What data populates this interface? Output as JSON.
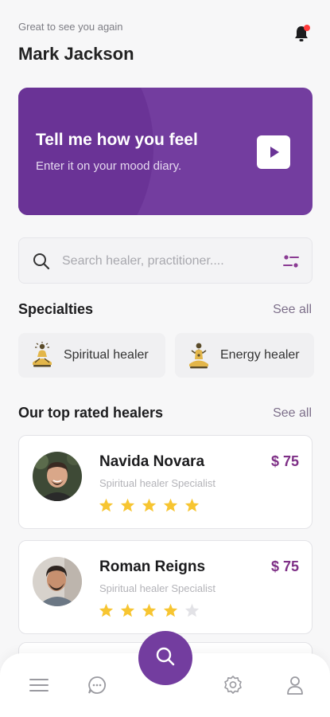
{
  "header": {
    "greeting": "Great to see you again",
    "username": "Mark Jackson",
    "notification_icon": "bell-icon"
  },
  "banner": {
    "title": "Tell me how you feel",
    "subtitle": "Enter it on your mood diary.",
    "action_icon": "play-icon",
    "color": "#733d9f"
  },
  "search": {
    "placeholder": "Search healer, practitioner....",
    "value": "",
    "icon": "search-icon",
    "filter_icon": "filter-icon"
  },
  "specialties": {
    "title": "Specialties",
    "see_all": "See all",
    "items": [
      {
        "label": "Spiritual healer",
        "icon": "spiritual-healer-icon"
      },
      {
        "label": "Energy healer",
        "icon": "energy-healer-icon"
      }
    ]
  },
  "healers": {
    "title": "Our top rated healers",
    "see_all": "See all",
    "items": [
      {
        "name": "Navida Novara",
        "role": "Spiritual healer Specialist",
        "price": "$ 75",
        "rating": 5,
        "max_rating": 5
      },
      {
        "name": "Roman Reigns",
        "role": "Spiritual healer Specialist",
        "price": "$ 75",
        "rating": 4,
        "max_rating": 5
      }
    ]
  },
  "bottom_nav": {
    "items": [
      "menu-icon",
      "chat-icon",
      "search-icon",
      "settings-icon",
      "profile-icon"
    ]
  },
  "colors": {
    "accent": "#733d9f",
    "price": "#7e2f86",
    "star": "#f7c531",
    "star_empty": "#e2e2e6",
    "notification_dot": "#ff3b3b"
  }
}
